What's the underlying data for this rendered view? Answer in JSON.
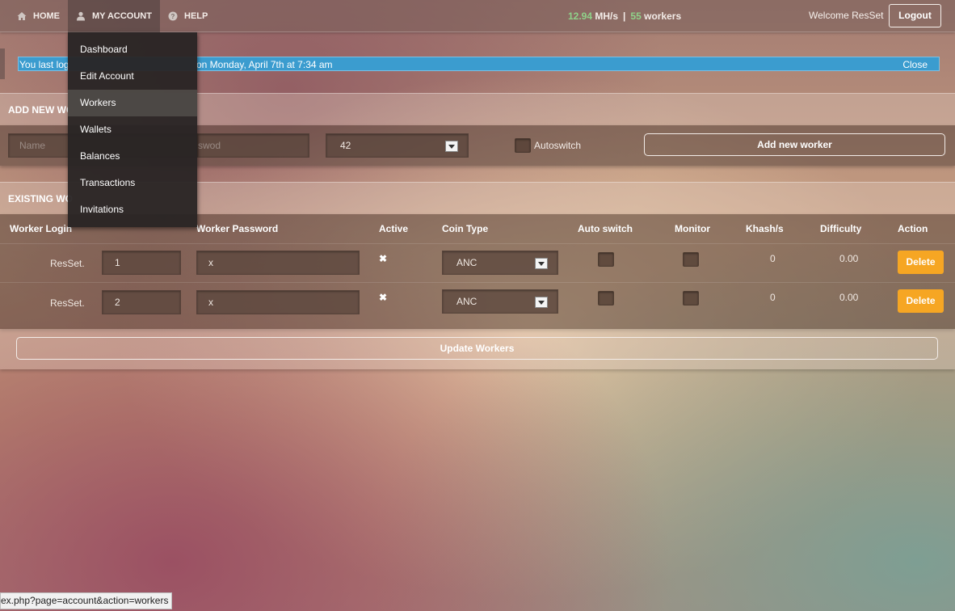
{
  "nav": {
    "home": "HOME",
    "my_account": "MY ACCOUNT",
    "help": "HELP"
  },
  "stats": {
    "hashrate_value": "12.94",
    "hashrate_unit": "MH/s",
    "separator": "|",
    "workers_value": "55",
    "workers_label": "workers"
  },
  "user": {
    "welcome": "Welcome ResSet",
    "logout": "Logout"
  },
  "notice": {
    "message_left": "You last log",
    "message_right": "on Monday, April 7th at 7:34 am",
    "close": "Close"
  },
  "account_menu": {
    "items": [
      "Dashboard",
      "Edit Account",
      "Workers",
      "Wallets",
      "Balances",
      "Transactions",
      "Invitations"
    ],
    "hovered": "Workers"
  },
  "add_worker": {
    "header_visible": "ADD NEW WO",
    "name_placeholder": "Name",
    "password_placeholder_visible": "swod",
    "coin_select_value": "42",
    "autoswitch_label": "Autoswitch",
    "add_button": "Add new worker"
  },
  "existing_workers": {
    "header_visible": "EXISTING WO",
    "columns": [
      "Worker Login",
      "Worker Password",
      "Active",
      "Coin Type",
      "Auto switch",
      "Monitor",
      "Khash/s",
      "Difficulty",
      "Action"
    ],
    "rows": [
      {
        "login_prefix": "ResSet.",
        "login_suffix": "1",
        "password": "x",
        "active_mark": "✖",
        "coin": "ANC",
        "khash": "0",
        "difficulty": "0.00",
        "action": "Delete"
      },
      {
        "login_prefix": "ResSet.",
        "login_suffix": "2",
        "password": "x",
        "active_mark": "✖",
        "coin": "ANC",
        "khash": "0",
        "difficulty": "0.00",
        "action": "Delete"
      }
    ],
    "update_button": "Update Workers"
  },
  "status_bar": {
    "url": "ex.php?page=account&action=workers"
  },
  "colors": {
    "notice_bg": "#3b9ccf",
    "delete_btn": "#f6a623",
    "stat_green": "#8fd28a"
  },
  "icons": {
    "home": "home-icon",
    "account": "user-icon",
    "help": "help-icon"
  }
}
